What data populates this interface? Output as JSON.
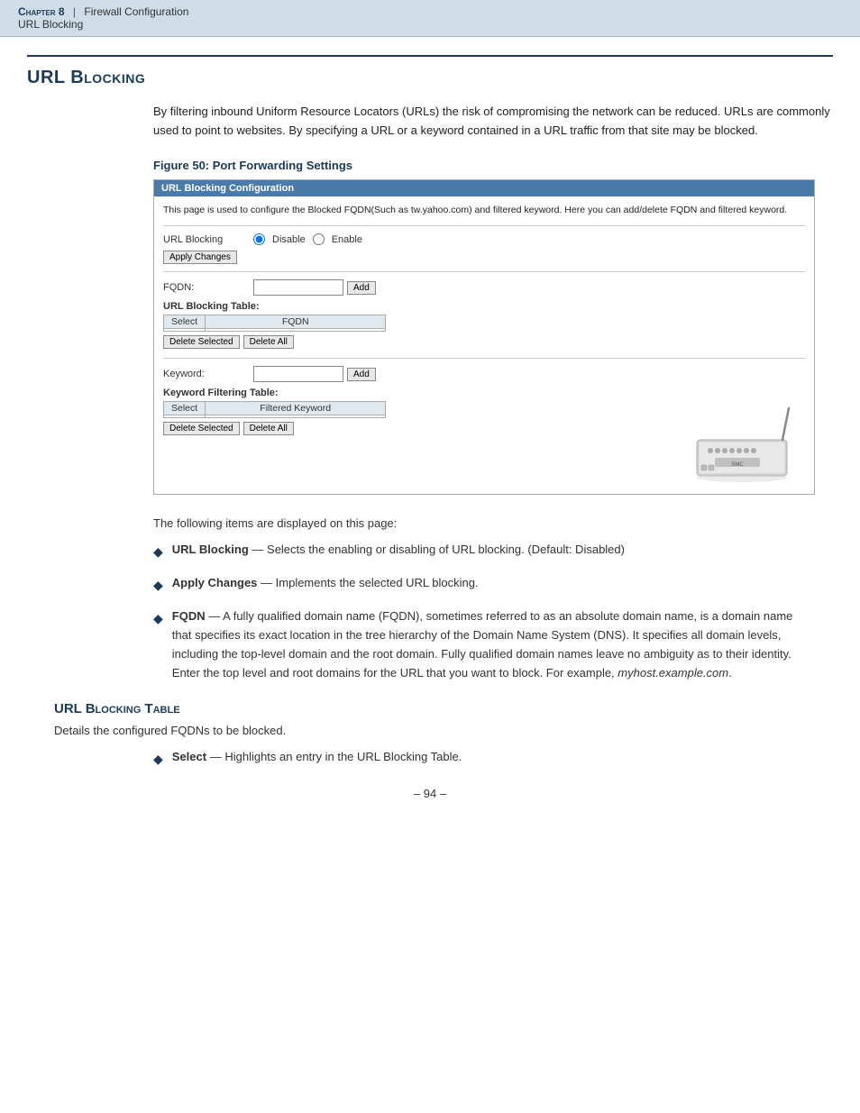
{
  "header": {
    "chapter": "Chapter 8",
    "separator": "|",
    "section": "Firewall Configuration",
    "subsection": "URL Blocking"
  },
  "section": {
    "title": "URL Blocking",
    "intro": "By filtering inbound Uniform Resource Locators (URLs) the risk of compromising the network can be reduced. URLs are commonly used to point to websites. By specifying a URL or a keyword contained in a URL traffic from that site may be blocked.",
    "figure_caption": "Figure 50:  Port Forwarding Settings"
  },
  "screenshot": {
    "title_bar": "URL Blocking Configuration",
    "description": "This page is used to configure the Blocked FQDN(Such as tw.yahoo.com) and filtered keyword. Here you can add/delete FQDN and filtered keyword.",
    "url_blocking_label": "URL Blocking",
    "disable_label": "Disable",
    "enable_label": "Enable",
    "apply_button": "Apply Changes",
    "fqdn_label": "FQDN:",
    "fqdn_add_button": "Add",
    "url_blocking_table_label": "URL Blocking Table:",
    "table_col_select": "Select",
    "table_col_fqdn": "FQDN",
    "delete_selected_1": "Delete Selected",
    "delete_all_1": "Delete All",
    "keyword_label": "Keyword:",
    "keyword_add_button": "Add",
    "keyword_table_label": "Keyword Filtering Table:",
    "table_col_select2": "Select",
    "table_col_filtered": "Filtered Keyword",
    "delete_selected_2": "Delete Selected",
    "delete_all_2": "Delete All"
  },
  "body_text": {
    "intro": "The following items are displayed on this page:",
    "bullets": [
      {
        "term": "URL Blocking",
        "desc": "— Selects the enabling or disabling of URL blocking. (Default: Disabled)"
      },
      {
        "term": "Apply Changes",
        "desc": "— Implements the selected URL blocking."
      },
      {
        "term": "FQDN",
        "desc": "— A fully qualified domain name (FQDN), sometimes referred to as an absolute domain name, is a domain name that specifies its exact location in the tree hierarchy of the Domain Name System (DNS). It specifies all domain levels, including the top-level domain and the root domain. Fully qualified domain names leave no ambiguity as to their identity. Enter the top level and root domains for the URL that you want to block. For example, myhost.example.com."
      }
    ]
  },
  "url_blocking_table_section": {
    "title": "URL Blocking Table",
    "desc": "Details the configured FQDNs to be blocked.",
    "bullets": [
      {
        "term": "Select",
        "desc": "— Highlights an entry in the URL Blocking Table."
      }
    ]
  },
  "footer": {
    "page_number": "–  94  –"
  }
}
